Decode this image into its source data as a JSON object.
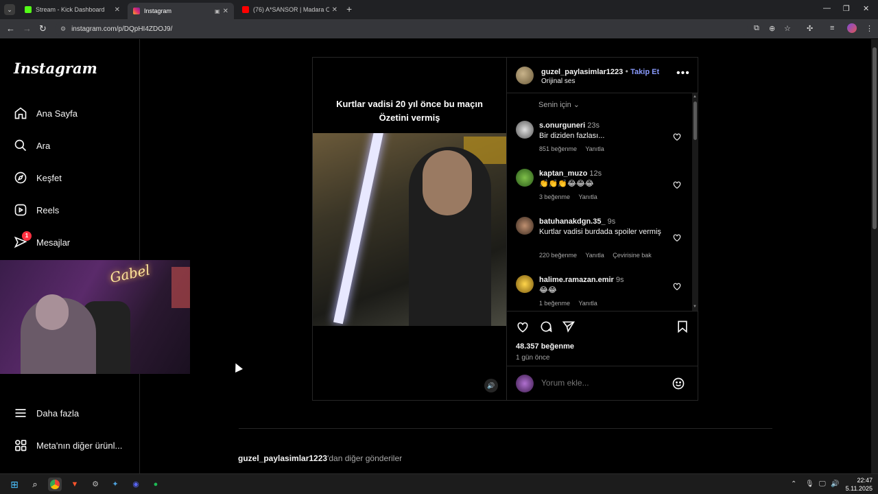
{
  "browser": {
    "tabs": [
      {
        "title": "Stream - Kick Dashboard",
        "color": "#53fc18"
      },
      {
        "title": "Instagram",
        "color": "#e1306c"
      },
      {
        "title": "(76) A*SANSOR | Madara Olduğ",
        "color": "#ff0000"
      }
    ],
    "url": "instagram.com/p/DQpHI4ZDOJ9/"
  },
  "instagram": {
    "logo": "Instagram",
    "nav": [
      {
        "label": "Ana Sayfa",
        "icon": "home-icon"
      },
      {
        "label": "Ara",
        "icon": "search-icon"
      },
      {
        "label": "Keşfet",
        "icon": "compass-icon"
      },
      {
        "label": "Reels",
        "icon": "reels-icon"
      },
      {
        "label": "Mesajlar",
        "icon": "messages-icon",
        "badge": "1"
      },
      {
        "label": "Daha fazla",
        "icon": "menu-icon"
      },
      {
        "label": "Meta'nın diğer ürünl...",
        "icon": "meta-apps-icon"
      }
    ]
  },
  "webcam": {
    "neon_sign": "Gabel"
  },
  "post": {
    "username": "guzel_paylasimlar1223",
    "separator": "•",
    "follow_label": "Takip Et",
    "audio": "Orijinal ses",
    "video_caption_line1": "Kurtlar vadisi 20 yıl önce bu maçın",
    "video_caption_line2": "Özetini vermiş",
    "sort_label": "Senin için",
    "comments": [
      {
        "user": "s.onurguneri",
        "time": "23s",
        "text": "Bir diziden fazlası...",
        "likes": "851 beğenme",
        "reply": "Yanıtla",
        "translate": ""
      },
      {
        "user": "kaptan_muzo",
        "time": "12s",
        "text": "👏👏👏😂😂😂",
        "likes": "3 beğenme",
        "reply": "Yanıtla",
        "translate": ""
      },
      {
        "user": "batuhanakdgn.35_",
        "time": "9s",
        "text": "Kurtlar vadisi burdada spoiler vermiş",
        "likes": "220 beğenme",
        "reply": "Yanıtla",
        "translate": "Çevirisine bak"
      },
      {
        "user": "halime.ramazan.emir",
        "time": "9s",
        "text": "😂😂",
        "likes": "1 beğenme",
        "reply": "Yanıtla",
        "translate": ""
      }
    ],
    "like_count": "48.357 beğenme",
    "posted": "1 gün önce",
    "comment_placeholder": "Yorum ekle...",
    "more_posts_user": "guzel_paylasimlar1223",
    "more_posts_suffix": "'dan diğer gönderiler"
  },
  "taskbar": {
    "time": "22:47",
    "date": "5.11.2025"
  }
}
